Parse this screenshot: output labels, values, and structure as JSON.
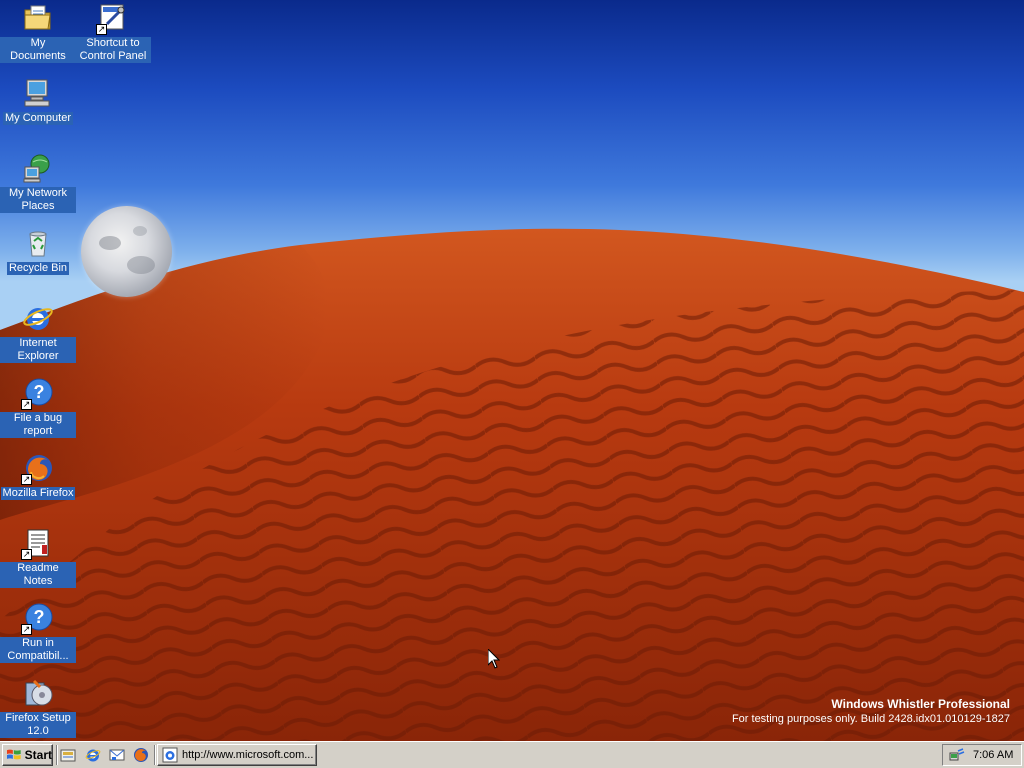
{
  "desktop": {
    "icons": [
      {
        "label": "My Documents",
        "icon": "folder-documents-icon"
      },
      {
        "label": "Shortcut to Control Panel",
        "icon": "control-panel-icon"
      },
      {
        "label": "My Computer",
        "icon": "computer-icon"
      },
      {
        "label": "My Network Places",
        "icon": "network-icon"
      },
      {
        "label": "Recycle Bin",
        "icon": "recycle-bin-icon"
      },
      {
        "label": "Internet Explorer",
        "icon": "internet-explorer-icon"
      },
      {
        "label": "File a bug report",
        "icon": "help-icon"
      },
      {
        "label": "Mozilla Firefox",
        "icon": "firefox-icon"
      },
      {
        "label": "Readme Notes",
        "icon": "notes-icon"
      },
      {
        "label": "Run in Compatibil...",
        "icon": "help-icon"
      },
      {
        "label": "Firefox Setup 12.0",
        "icon": "setup-icon"
      }
    ],
    "watermark": {
      "line1": "Windows Whistler Professional",
      "line2": "For testing purposes only. Build 2428.idx01.010129-1827"
    }
  },
  "taskbar": {
    "start_label": "Start",
    "quick_launch": [
      "show-desktop-icon",
      "internet-explorer-icon",
      "outlook-express-icon",
      "firefox-icon"
    ],
    "task_button_label": "http://www.microsoft.com...",
    "clock": "7:06 AM"
  },
  "colors": {
    "sky_top": "#0a2a8c",
    "sky_bottom": "#a9d0f4",
    "dune": "#b83a10",
    "taskbar": "#d4d0c8",
    "icon_label_bg": "#2b63b4"
  }
}
